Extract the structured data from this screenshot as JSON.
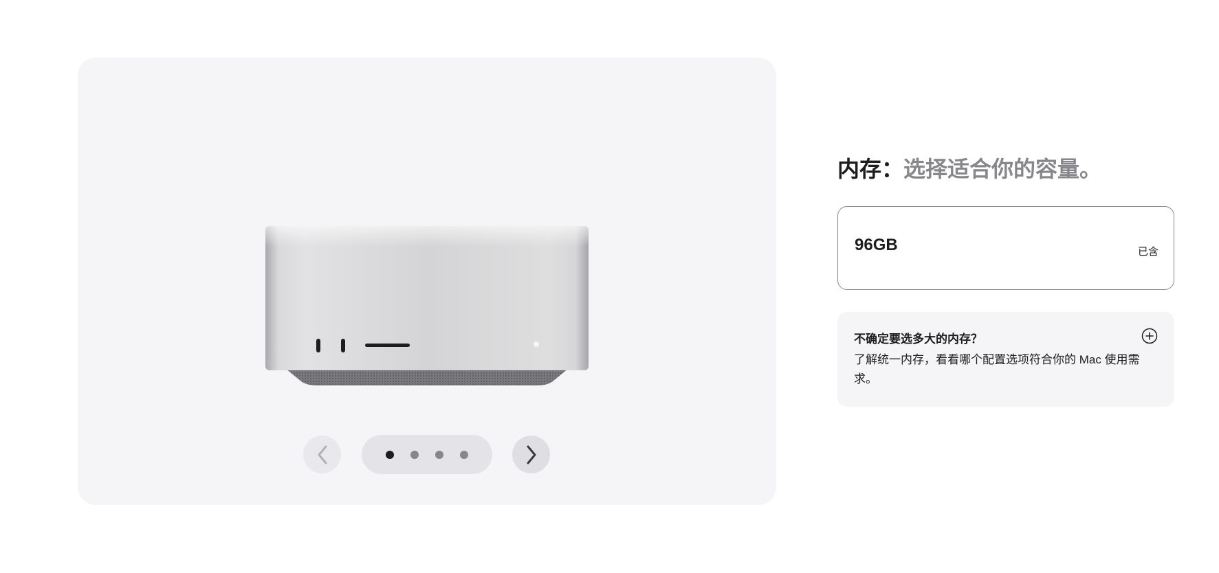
{
  "gallery": {
    "image_alt": "Mac Studio",
    "prev_icon": "chevron-left-icon",
    "next_icon": "chevron-right-icon",
    "dots": [
      {
        "active": true
      },
      {
        "active": false
      },
      {
        "active": false
      },
      {
        "active": false
      }
    ]
  },
  "memory": {
    "title_strong": "内存：",
    "title_soft": "选择适合你的容量。",
    "option": {
      "size": "96GB",
      "price": "已含"
    },
    "help": {
      "title": "不确定要选多大的内存？",
      "body": "了解统一内存，看看哪个配置选项符合你的 Mac 使用需求。",
      "icon": "plus-circle-icon"
    }
  },
  "colors": {
    "card_bg": "#f5f5f7",
    "text": "#1d1d1f",
    "muted": "#86868b"
  }
}
